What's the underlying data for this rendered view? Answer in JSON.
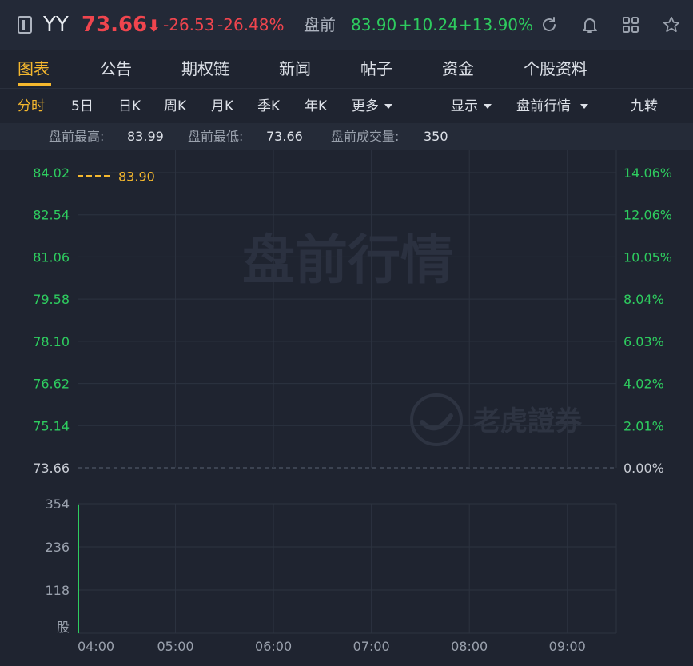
{
  "header": {
    "symbol": "YY",
    "price": "73.66",
    "change": "-26.53",
    "change_pct": "-26.48%",
    "premarket_label": "盘前",
    "premarket_price": "83.90",
    "premarket_change": "+10.24",
    "premarket_change_pct": "+13.90%",
    "colors": {
      "down": "#f0454e",
      "up": "#2ecc5f"
    }
  },
  "tabs": [
    "图表",
    "公告",
    "期权链",
    "新闻",
    "帖子",
    "资金",
    "个股资料"
  ],
  "active_tab": "图表",
  "periods": {
    "items": [
      "分时",
      "5日",
      "日K",
      "周K",
      "月K",
      "季K",
      "年K"
    ],
    "more": "更多",
    "active": "分时",
    "display": "显示",
    "premarket": "盘前行情",
    "nine_turn": "九转"
  },
  "stats": {
    "high_label": "盘前最高:",
    "high": "83.99",
    "low_label": "盘前最低:",
    "low": "73.66",
    "volume_label": "盘前成交量:",
    "volume": "350"
  },
  "watermark": {
    "title": "盘前行情",
    "brand": "老虎證券"
  },
  "chart_data": {
    "type": "line",
    "x_labels": [
      "04:00",
      "05:00",
      "06:00",
      "07:00",
      "08:00",
      "09:00"
    ],
    "price_axis": [
      "84.02",
      "82.54",
      "81.06",
      "79.58",
      "78.10",
      "76.62",
      "75.14",
      "73.66"
    ],
    "percent_axis": [
      "14.06%",
      "12.06%",
      "10.05%",
      "8.04%",
      "6.03%",
      "4.02%",
      "2.01%",
      "0.00%"
    ],
    "ylim": [
      73.66,
      84.02
    ],
    "reference_price": 73.66,
    "current_price_line": {
      "value": 83.9,
      "label": "83.90",
      "color": "#f5b82e"
    },
    "volume_axis": [
      "354",
      "236",
      "118"
    ],
    "volume_unit": "股",
    "volume_ylim": [
      0,
      354
    ],
    "volume_series": [
      {
        "time": "04:00",
        "value": 350,
        "color": "#2ecc5f"
      }
    ],
    "grid": true
  }
}
